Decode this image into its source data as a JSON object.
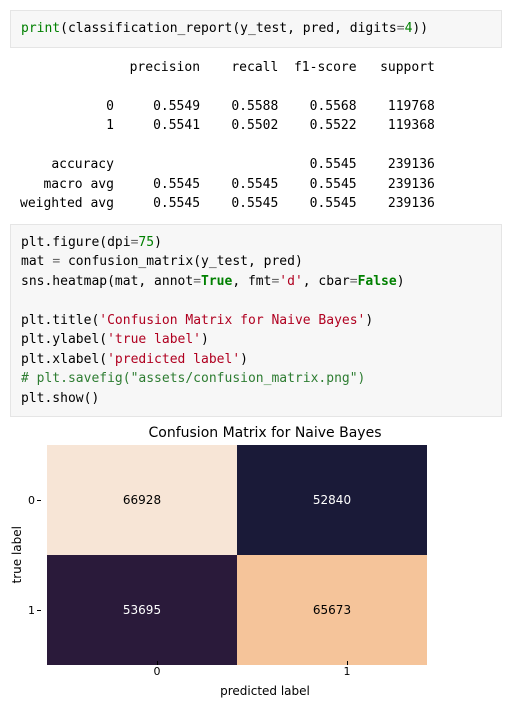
{
  "code_cell_1": {
    "fn": "print",
    "inner_fn": "classification_report",
    "args1": "y_test",
    "args2": "pred",
    "kwarg": "digits",
    "kwval": "4"
  },
  "report": {
    "header_precision": "precision",
    "header_recall": "recall",
    "header_f1": "f1-score",
    "header_support": "support",
    "rows": [
      {
        "label": "0",
        "precision": "0.5549",
        "recall": "0.5588",
        "f1": "0.5568",
        "support": "119768"
      },
      {
        "label": "1",
        "precision": "0.5541",
        "recall": "0.5502",
        "f1": "0.5522",
        "support": "119368"
      }
    ],
    "accuracy_label": "accuracy",
    "accuracy_f1": "0.5545",
    "accuracy_support": "239136",
    "macro_label": "macro avg",
    "macro": {
      "precision": "0.5545",
      "recall": "0.5545",
      "f1": "0.5545",
      "support": "239136"
    },
    "weighted_label": "weighted avg",
    "weighted": {
      "precision": "0.5545",
      "recall": "0.5545",
      "f1": "0.5545",
      "support": "239136"
    }
  },
  "code_cell_2": {
    "l1a": "plt.figure(dpi",
    "l1b": "75",
    "l2a": "mat ",
    "l2b": " confusion_matrix(y_test, pred)",
    "l3a": "sns.heatmap(mat, annot",
    "l3b": "True",
    "l3c": ", fmt",
    "l3d": "'d'",
    "l3e": ", cbar",
    "l3f": "False",
    "l4a": "plt.title(",
    "l4b": "'Confusion Matrix for Naive Bayes'",
    "l5a": "plt.ylabel(",
    "l5b": "'true label'",
    "l6a": "plt.xlabel(",
    "l6b": "'predicted label'",
    "l7": "# plt.savefig(\"assets/confusion_matrix.png\")",
    "l8": "plt.show()"
  },
  "chart_data": {
    "type": "heatmap",
    "title": "Confusion Matrix for Naive Bayes",
    "xlabel": "predicted label",
    "ylabel": "true label",
    "x_categories": [
      "0",
      "1"
    ],
    "y_categories": [
      "0",
      "1"
    ],
    "values": [
      [
        66928,
        52840
      ],
      [
        53695,
        65673
      ]
    ],
    "annot": true,
    "cbar": false
  }
}
